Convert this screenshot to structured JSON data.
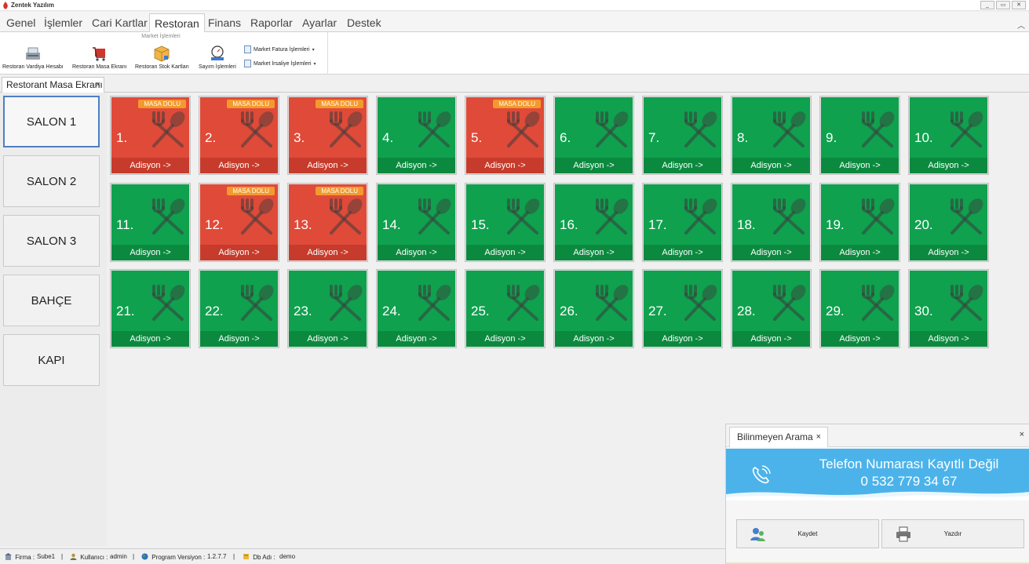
{
  "app": {
    "title": "Zentek Yazılım",
    "window_buttons": [
      "_",
      "▭",
      "✕"
    ]
  },
  "menu": {
    "tabs": [
      "Genel",
      "İşlemler",
      "Cari Kartlar",
      "Restoran",
      "Finans",
      "Raporlar",
      "Ayarlar",
      "Destek"
    ],
    "active": "Restoran",
    "collapse_glyph": "︿"
  },
  "ribbon": {
    "group_title": "Market İşlemleri",
    "buttons": [
      {
        "label": "Restoran Vardiya Hesabı",
        "icon": "cash-register-icon"
      },
      {
        "label": "Restoran Masa Ekranı",
        "icon": "shopping-cart-icon"
      },
      {
        "label": "Restoran Stok Kartları",
        "icon": "box-icon"
      },
      {
        "label": "Sayım İşlemleri",
        "icon": "scale-icon"
      }
    ],
    "small_buttons": [
      {
        "label": "Market Fatura İşlemleri",
        "caret": "▾"
      },
      {
        "label": "Market İrsaliye İşlemleri",
        "caret": "▾"
      }
    ]
  },
  "doc_tab": {
    "label": "Restorant Masa Ekranı",
    "close": "×"
  },
  "salons": [
    "SALON 1",
    "SALON 2",
    "SALON 3",
    "BAHÇE",
    "KAPI"
  ],
  "active_salon": "SALON 1",
  "tables": {
    "footer_label": "Adisyon ->",
    "busy_badge": "MASA DOLU",
    "items": [
      {
        "num": "1.",
        "status": "busy"
      },
      {
        "num": "2.",
        "status": "busy"
      },
      {
        "num": "3.",
        "status": "busy"
      },
      {
        "num": "4.",
        "status": "free"
      },
      {
        "num": "5.",
        "status": "busy"
      },
      {
        "num": "6.",
        "status": "free"
      },
      {
        "num": "7.",
        "status": "free"
      },
      {
        "num": "8.",
        "status": "free"
      },
      {
        "num": "9.",
        "status": "free"
      },
      {
        "num": "10.",
        "status": "free"
      },
      {
        "num": "11.",
        "status": "free"
      },
      {
        "num": "12.",
        "status": "busy"
      },
      {
        "num": "13.",
        "status": "busy"
      },
      {
        "num": "14.",
        "status": "free"
      },
      {
        "num": "15.",
        "status": "free"
      },
      {
        "num": "16.",
        "status": "free"
      },
      {
        "num": "17.",
        "status": "free"
      },
      {
        "num": "18.",
        "status": "free"
      },
      {
        "num": "19.",
        "status": "free"
      },
      {
        "num": "20.",
        "status": "free"
      },
      {
        "num": "21.",
        "status": "free"
      },
      {
        "num": "22.",
        "status": "free"
      },
      {
        "num": "23.",
        "status": "free"
      },
      {
        "num": "24.",
        "status": "free"
      },
      {
        "num": "25.",
        "status": "free"
      },
      {
        "num": "26.",
        "status": "free"
      },
      {
        "num": "27.",
        "status": "free"
      },
      {
        "num": "28.",
        "status": "free"
      },
      {
        "num": "29.",
        "status": "free"
      },
      {
        "num": "30.",
        "status": "free"
      }
    ],
    "colors": {
      "free": "#0fa14e",
      "busy": "#e04a38",
      "badge": "#f39a2e"
    }
  },
  "call_popup": {
    "tab_label": "Bilinmeyen Arama",
    "tab_close": "×",
    "close": "×",
    "title": "Telefon Numarası Kayıtlı Değil",
    "number": "0 532 779 34 67",
    "save_label": "Kaydet",
    "print_label": "Yazdır",
    "banner_color": "#4cb3ea"
  },
  "status": {
    "firm_label": "Firma :",
    "firm_value": "Sube1",
    "user_label": "Kullanıcı :",
    "user_value": "admin",
    "version_label": "Program Versiyon :",
    "version_value": "1.2.7.7",
    "db_label": "Db Adı :",
    "db_value": "demo",
    "separator": "|"
  }
}
